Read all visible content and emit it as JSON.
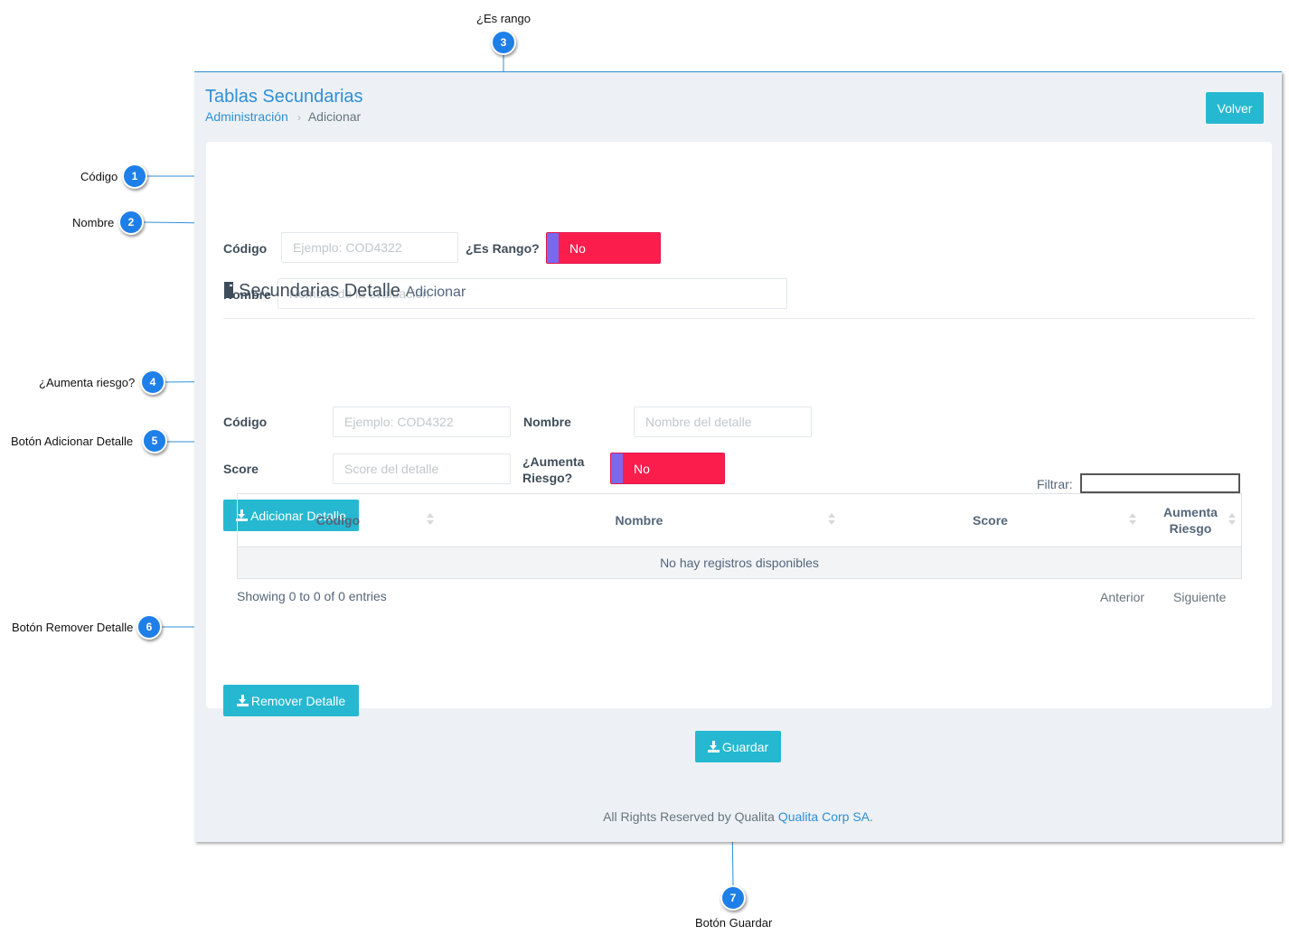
{
  "annotations": [
    {
      "number": "1",
      "label": "Código"
    },
    {
      "number": "2",
      "label": "Nombre"
    },
    {
      "number": "3",
      "label": "¿Es rango"
    },
    {
      "number": "4",
      "label": "¿Aumenta riesgo?"
    },
    {
      "number": "5",
      "label": "Botón  Adicionar Detalle"
    },
    {
      "number": "6",
      "label": "Botón Remover Detalle"
    },
    {
      "number": "7",
      "label": "Botón Guardar"
    }
  ],
  "header": {
    "title": "Tablas Secundarias",
    "breadcrumb": [
      "Administración",
      "Adicionar"
    ],
    "back_button": "Volver"
  },
  "form": {
    "codigo_label": "Código",
    "codigo_placeholder": "Ejemplo: COD4322",
    "es_rango_label": "¿Es Rango?",
    "es_rango_value": "No",
    "nombre_label": "Nombre",
    "nombre_placeholder": "Nombre de la evaluación"
  },
  "detail": {
    "title": "Secundarias Detalle",
    "subtitle": "Adicionar",
    "codigo_label": "Código",
    "codigo_placeholder": "Ejemplo: COD4322",
    "nombre_label": "Nombre",
    "nombre_placeholder": "Nombre del detalle",
    "score_label": "Score",
    "score_placeholder": "Score del detalle",
    "aumenta_label_line1": "¿Aumenta",
    "aumenta_label_line2": "Riesgo?",
    "aumenta_value": "No",
    "add_button": "Adicionar Detalle",
    "remove_button": "Remover Detalle"
  },
  "table": {
    "filter_label": "Filtrar:",
    "columns": [
      "Código",
      "Nombre",
      "Score",
      "Aumenta Riesgo"
    ],
    "empty_message": "No hay registros disponibles",
    "info": "Showing 0 to 0 of 0 entries",
    "prev": "Anterior",
    "next": "Siguiente"
  },
  "save_button": "Guardar",
  "footer": {
    "text": "All Rights Reserved by Qualita",
    "link": "Qualita Corp SA."
  },
  "colors": {
    "primary": "#2f8fd6",
    "info_button": "#26b8d1",
    "toggle_off": "#fb1e4d",
    "toggle_knob": "#7b68ee",
    "annotation": "#1f7fe8"
  }
}
